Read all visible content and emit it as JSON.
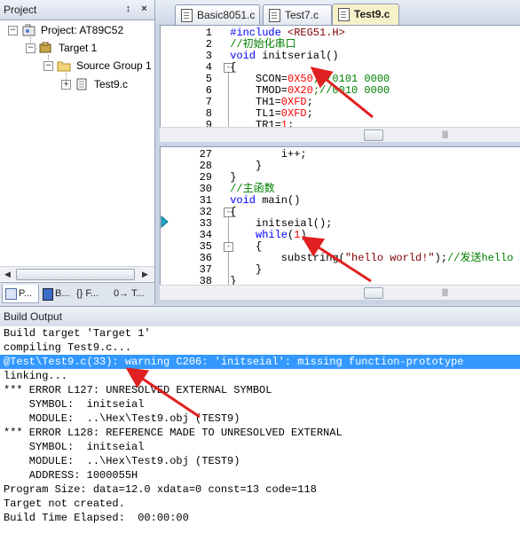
{
  "project_panel": {
    "title": "Project",
    "pin_glyph": "↕",
    "close_glyph": "×",
    "tree": {
      "root": "Project: AT89C52",
      "target": "Target 1",
      "group": "Source Group 1",
      "file": "Test9.c"
    },
    "tabs": [
      "P...",
      "B...",
      "{} F...",
      "0→ T..."
    ]
  },
  "editor": {
    "tabs": [
      {
        "label": "Basic8051.c",
        "active": false
      },
      {
        "label": "Test7.c",
        "active": false
      },
      {
        "label": "Test9.c",
        "active": true
      }
    ],
    "top_pane_lines": [
      {
        "n": "1",
        "fold": "",
        "segs": [
          {
            "t": "#include ",
            "c": "pp"
          },
          {
            "t": "<REG51.H>",
            "c": "str"
          }
        ]
      },
      {
        "n": "2",
        "fold": "",
        "segs": [
          {
            "t": "//初始化串口",
            "c": "cm"
          }
        ]
      },
      {
        "n": "3",
        "fold": "",
        "segs": [
          {
            "t": "void",
            "c": "kw"
          },
          {
            "t": " initserial()",
            "c": ""
          }
        ]
      },
      {
        "n": "4",
        "fold": "-",
        "segs": [
          {
            "t": "{",
            "c": ""
          }
        ]
      },
      {
        "n": "5",
        "fold": "",
        "segs": [
          {
            "t": "    SCON=",
            "c": ""
          },
          {
            "t": "0X50",
            "c": "num"
          },
          {
            "t": ";//0101 0000",
            "c": "cm"
          }
        ]
      },
      {
        "n": "6",
        "fold": "",
        "segs": [
          {
            "t": "    TMOD=",
            "c": ""
          },
          {
            "t": "0X20",
            "c": "num"
          },
          {
            "t": ";//0010 0000",
            "c": "cm"
          }
        ]
      },
      {
        "n": "7",
        "fold": "",
        "segs": [
          {
            "t": "    TH1=",
            "c": ""
          },
          {
            "t": "0XFD",
            "c": "num"
          },
          {
            "t": ";",
            "c": ""
          }
        ]
      },
      {
        "n": "8",
        "fold": "",
        "segs": [
          {
            "t": "    TL1=",
            "c": ""
          },
          {
            "t": "0XFD",
            "c": "num"
          },
          {
            "t": ";",
            "c": ""
          }
        ]
      },
      {
        "n": "9",
        "fold": "",
        "segs": [
          {
            "t": "    TR1=",
            "c": ""
          },
          {
            "t": "1",
            "c": "num"
          },
          {
            "t": ";",
            "c": ""
          }
        ]
      }
    ],
    "bottom_pane_lines": [
      {
        "n": "27",
        "fold": "",
        "segs": [
          {
            "t": "        i++;",
            "c": ""
          }
        ]
      },
      {
        "n": "28",
        "fold": "",
        "segs": [
          {
            "t": "    }",
            "c": ""
          }
        ]
      },
      {
        "n": "29",
        "fold": "",
        "segs": [
          {
            "t": "}",
            "c": ""
          }
        ]
      },
      {
        "n": "30",
        "fold": "",
        "segs": [
          {
            "t": "//主函数",
            "c": "cm"
          }
        ]
      },
      {
        "n": "31",
        "fold": "",
        "segs": [
          {
            "t": "void",
            "c": "kw"
          },
          {
            "t": " main()",
            "c": ""
          }
        ]
      },
      {
        "n": "32",
        "fold": "-",
        "segs": [
          {
            "t": "{",
            "c": ""
          }
        ]
      },
      {
        "n": "33",
        "fold": "",
        "segs": [
          {
            "t": "    initseial();",
            "c": ""
          }
        ]
      },
      {
        "n": "34",
        "fold": "",
        "segs": [
          {
            "t": "    ",
            "c": ""
          },
          {
            "t": "while",
            "c": "kw"
          },
          {
            "t": "(",
            "c": ""
          },
          {
            "t": "1",
            "c": "num"
          },
          {
            "t": ")",
            "c": ""
          }
        ]
      },
      {
        "n": "35",
        "fold": "-",
        "segs": [
          {
            "t": "    {",
            "c": ""
          }
        ]
      },
      {
        "n": "36",
        "fold": "",
        "segs": [
          {
            "t": "        substring(",
            "c": ""
          },
          {
            "t": "\"hello world!\"",
            "c": "str"
          },
          {
            "t": ");",
            "c": ""
          },
          {
            "t": "//发送hello wo",
            "c": "cm"
          }
        ]
      },
      {
        "n": "37",
        "fold": "",
        "segs": [
          {
            "t": "    }",
            "c": ""
          }
        ]
      },
      {
        "n": "38",
        "fold": "",
        "segs": [
          {
            "t": "}",
            "c": ""
          }
        ]
      }
    ]
  },
  "build_output": {
    "title": "Build Output",
    "lines": [
      {
        "text": "Build target 'Target 1'",
        "selected": false
      },
      {
        "text": "compiling Test9.c...",
        "selected": false
      },
      {
        "text": "@Test\\Test9.c(33): warning C206: 'initseial': missing function-prototype",
        "selected": true
      },
      {
        "text": "linking...",
        "selected": false
      },
      {
        "text": "*** ERROR L127: UNRESOLVED EXTERNAL SYMBOL",
        "selected": false
      },
      {
        "text": "    SYMBOL:  initseial",
        "selected": false
      },
      {
        "text": "    MODULE:  ..\\Hex\\Test9.obj (TEST9)",
        "selected": false
      },
      {
        "text": "*** ERROR L128: REFERENCE MADE TO UNRESOLVED EXTERNAL",
        "selected": false
      },
      {
        "text": "    SYMBOL:  initseial",
        "selected": false
      },
      {
        "text": "    MODULE:  ..\\Hex\\Test9.obj (TEST9)",
        "selected": false
      },
      {
        "text": "    ADDRESS: 1000055H",
        "selected": false
      },
      {
        "text": "Program Size: data=12.0 xdata=0 const=13 code=118",
        "selected": false
      },
      {
        "text": "Target not created.",
        "selected": false
      },
      {
        "text": "Build Time Elapsed:  00:00:00",
        "selected": false
      }
    ]
  },
  "colors": {
    "annotation_arrow": "#e02020",
    "selection": "#3399ff",
    "active_tab": "#f6f1c9"
  }
}
